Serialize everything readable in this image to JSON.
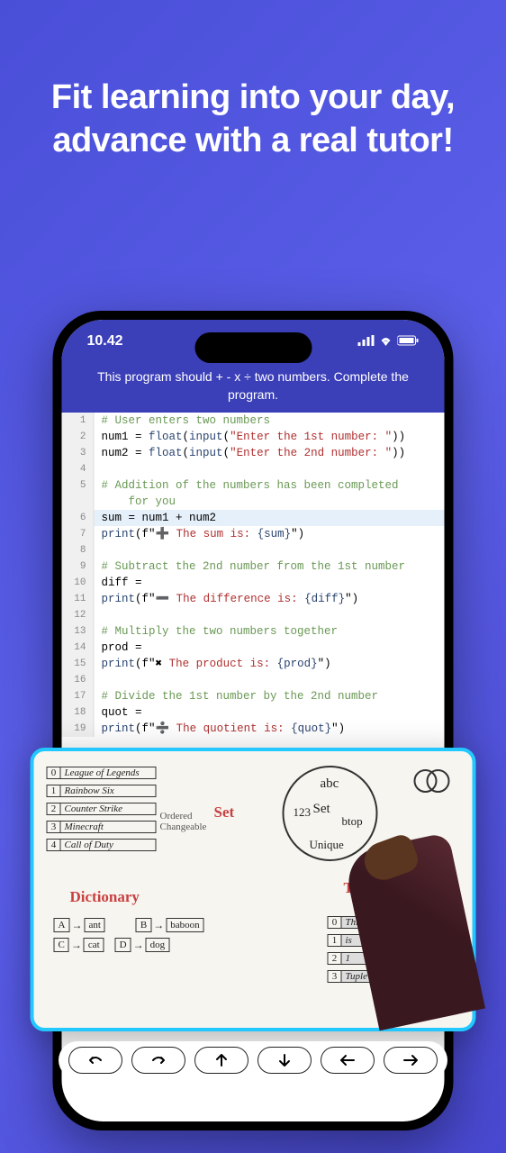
{
  "headline": "Fit learning into your day, advance with a real tutor!",
  "status": {
    "time": "10.42"
  },
  "instruction": "This program should + - x ÷ two numbers. Complete the program.",
  "code": {
    "lines": [
      {
        "n": 1,
        "comment": "# User enters two numbers"
      },
      {
        "n": 2,
        "text_pre": "num1 = ",
        "func": "float",
        "paren_o": "(",
        "func2": "input",
        "paren_o2": "(",
        "str": "\"Enter the 1st number: \"",
        "paren_c": "))"
      },
      {
        "n": 3,
        "text_pre": "num2 = ",
        "func": "float",
        "paren_o": "(",
        "func2": "input",
        "paren_o2": "(",
        "str": "\"Enter the 2nd number: \"",
        "paren_c": "))"
      },
      {
        "n": 4,
        "blank": true
      },
      {
        "n": 5,
        "comment": "# Addition of the numbers has been completed\n    for you"
      },
      {
        "n": 6,
        "highlight": true,
        "text": "sum = num1 + num2"
      },
      {
        "n": 7,
        "print": true,
        "sym": "➕",
        "label": " The sum is: ",
        "var": "{sum}"
      },
      {
        "n": 8,
        "blank": true
      },
      {
        "n": 9,
        "comment": "# Subtract the 2nd number from the 1st number"
      },
      {
        "n": 10,
        "text": "diff ="
      },
      {
        "n": 11,
        "print": true,
        "sym": "➖",
        "label": " The difference is: ",
        "var": "{diff}"
      },
      {
        "n": 12,
        "blank": true
      },
      {
        "n": 13,
        "comment": "# Multiply the two numbers together"
      },
      {
        "n": 14,
        "text": "prod ="
      },
      {
        "n": 15,
        "print": true,
        "sym": "✖",
        "label": " The product is: ",
        "var": "{prod}"
      },
      {
        "n": 16,
        "blank": true
      },
      {
        "n": 17,
        "comment": "# Divide the 1st number by the 2nd number"
      },
      {
        "n": 18,
        "text": "quot ="
      },
      {
        "n": 19,
        "print": true,
        "sym": "➗",
        "label": " The quotient is: ",
        "var": "{quot}"
      }
    ]
  },
  "whiteboard": {
    "list_label": "Ordered\nChangeable",
    "list_items": [
      {
        "idx": "0",
        "val": "League of Legends"
      },
      {
        "idx": "1",
        "val": "Rainbow Six"
      },
      {
        "idx": "2",
        "val": "Counter Strike"
      },
      {
        "idx": "3",
        "val": "Minecraft"
      },
      {
        "idx": "4",
        "val": "Call of Duty"
      }
    ],
    "set_label": "Set",
    "set_items": "abc\nSet\n123   btop",
    "set_note": "Unique",
    "dict_label": "Dictionary",
    "dict_pairs": [
      {
        "k": "A",
        "v": "ant"
      },
      {
        "k": "B",
        "v": "baboon"
      },
      {
        "k": "C",
        "v": "cat"
      },
      {
        "k": "D",
        "v": "dog"
      }
    ],
    "tuple_label": "Tuple",
    "tuple_items": [
      {
        "idx": "0",
        "val": "This"
      },
      {
        "idx": "1",
        "val": "is"
      },
      {
        "idx": "2",
        "val": "1"
      },
      {
        "idx": "3",
        "val": "Tuple"
      }
    ]
  },
  "toolbar": {
    "buttons": [
      "undo",
      "redo",
      "up",
      "down",
      "left",
      "right"
    ]
  }
}
